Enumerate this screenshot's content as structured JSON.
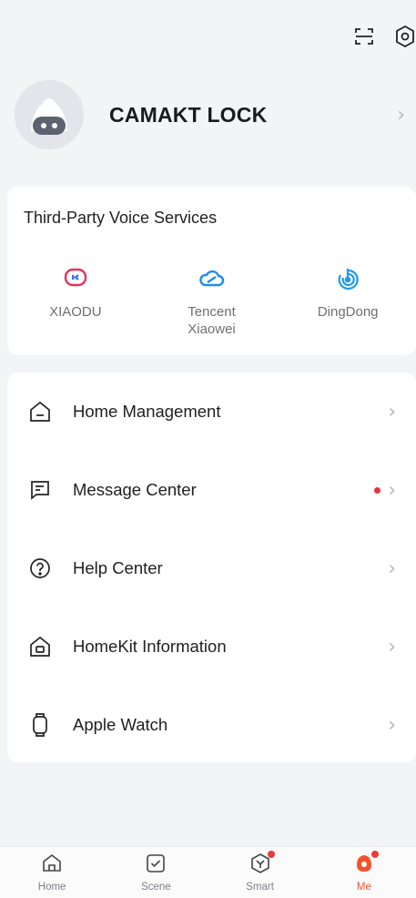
{
  "profile": {
    "name": "CAMAKT LOCK"
  },
  "voice_services": {
    "title": "Third-Party Voice Services",
    "items": [
      {
        "label": "XIAODU",
        "icon": "xiaodu-icon"
      },
      {
        "label": "Tencent\nXiaowei",
        "icon": "tencent-cloud-icon"
      },
      {
        "label": "DingDong",
        "icon": "dingdong-icon"
      }
    ]
  },
  "menu": [
    {
      "label": "Home Management",
      "icon": "home-outline-icon"
    },
    {
      "label": "Message Center",
      "icon": "message-icon",
      "unread_dot": true
    },
    {
      "label": "Help Center",
      "icon": "help-icon"
    },
    {
      "label": "HomeKit Information",
      "icon": "homekit-icon"
    },
    {
      "label": "Apple Watch",
      "icon": "watch-icon"
    }
  ],
  "tabs": [
    {
      "label": "Home",
      "icon": "home-tab-icon"
    },
    {
      "label": "Scene",
      "icon": "scene-tab-icon"
    },
    {
      "label": "Smart",
      "icon": "smart-tab-icon"
    },
    {
      "label": "Me",
      "icon": "me-tab-icon",
      "active": true
    }
  ],
  "colors": {
    "accent": "#f2542a",
    "badge": "#ea3a3a",
    "background": "#f3f4f6"
  }
}
